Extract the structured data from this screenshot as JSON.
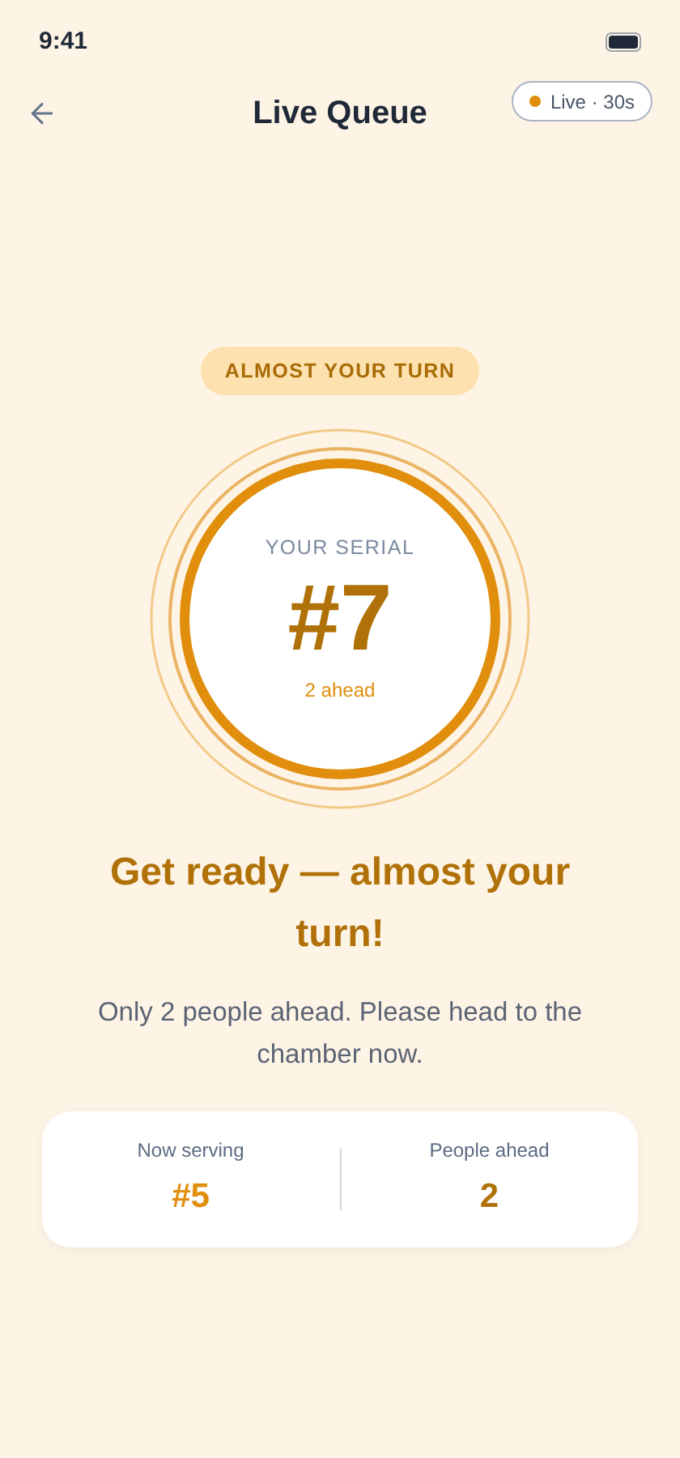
{
  "status_bar": {
    "time": "9:41"
  },
  "header": {
    "title": "Live Queue",
    "live_badge": {
      "label": "Live · 30s",
      "on": true
    }
  },
  "status_badge": "ALMOST YOUR TURN",
  "serial": {
    "caption": "YOUR SERIAL",
    "number": "#7",
    "ahead": "2 ahead"
  },
  "headline": "Get ready — almost your turn!",
  "message": "Only 2 people ahead. Please head to the chamber now.",
  "stats": [
    {
      "label": "Now serving",
      "value": "#5",
      "color": "#e08e0b"
    },
    {
      "label": "People ahead",
      "value": "2",
      "color": "#b07208"
    }
  ]
}
